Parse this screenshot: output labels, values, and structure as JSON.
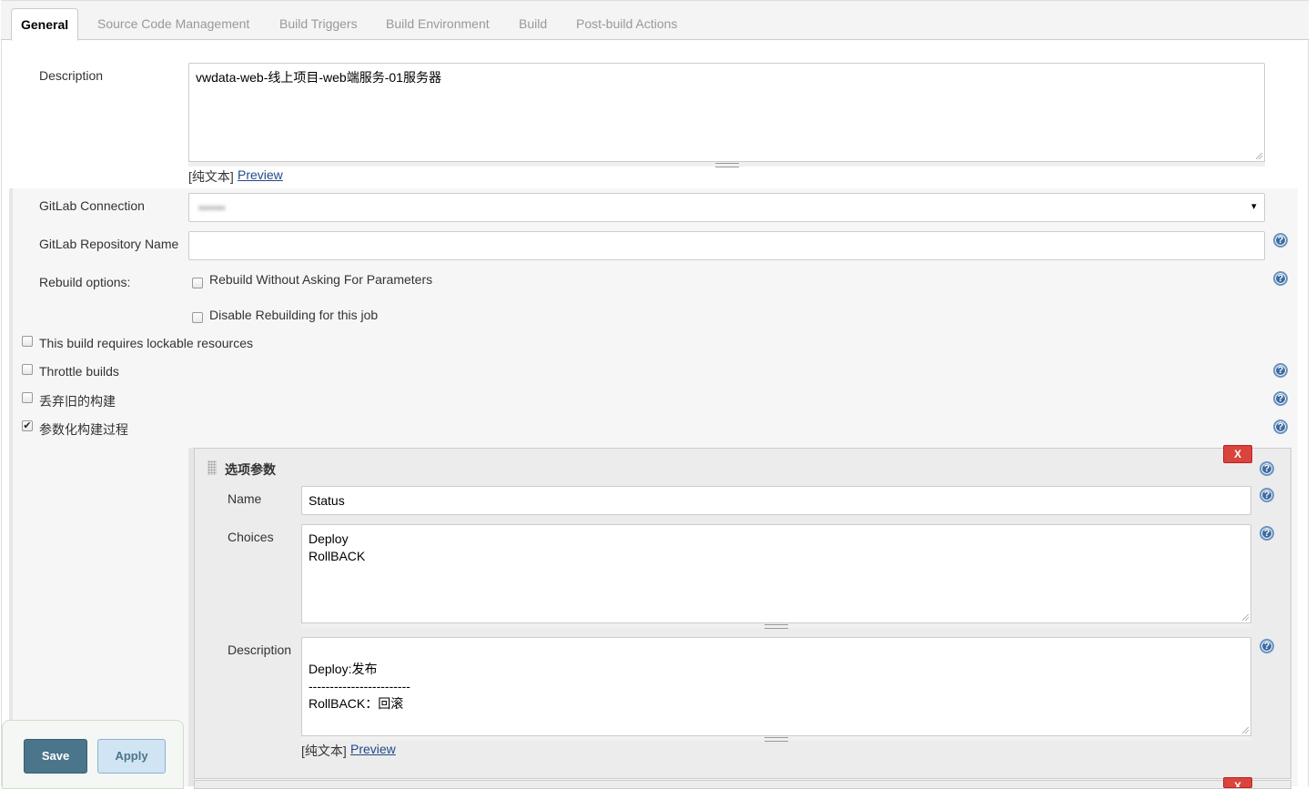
{
  "tabs": [
    {
      "label": "General",
      "active": true
    },
    {
      "label": "Source Code Management"
    },
    {
      "label": "Build Triggers"
    },
    {
      "label": "Build Environment"
    },
    {
      "label": "Build"
    },
    {
      "label": "Post-build Actions"
    }
  ],
  "general": {
    "description_label": "Description",
    "description_value": "vwdata-web-线上项目-web端服务-01服务器",
    "plain_text": "[纯文本]",
    "preview_link": "Preview",
    "gitlab_connection_label": "GitLab Connection",
    "gitlab_connection_value": "••••••",
    "gitlab_repo_label": "GitLab Repository Name",
    "gitlab_repo_value": "",
    "rebuild_label": "Rebuild options:",
    "rebuild_without_asking": "Rebuild Without Asking For Parameters",
    "disable_rebuilding": "Disable Rebuilding for this job",
    "lockable": "This build requires lockable resources",
    "throttle": "Throttle builds",
    "discard_old": "丢弃旧的构建",
    "parameterized": "参数化构建过程"
  },
  "checkbox_states": {
    "rebuild_without_asking": false,
    "disable_rebuilding": false,
    "lockable": false,
    "throttle": false,
    "discard_old": false,
    "parameterized": true
  },
  "param": {
    "title": "选项参数",
    "delete_label": "X",
    "name_label": "Name",
    "name_value": "Status",
    "choices_label": "Choices",
    "choices_value": "Deploy\nRollBACK",
    "description_label": "Description",
    "description_value": "\nDeploy:发布\n------------------------\nRollBACK：回滚",
    "plain_text": "[纯文本]",
    "preview_link": "Preview"
  },
  "actions": {
    "save_label": "Save",
    "apply_label": "Apply"
  },
  "icons": {
    "help": "help-icon",
    "dropdown": "chevron-down-icon",
    "check": "✔",
    "help_glyph": "?"
  },
  "colors": {
    "help_icon": "#3d6b9e",
    "delete_button": "#d9443d",
    "save_button": "#4b758b",
    "apply_button": "#d1e4f3",
    "link": "#204a87"
  }
}
